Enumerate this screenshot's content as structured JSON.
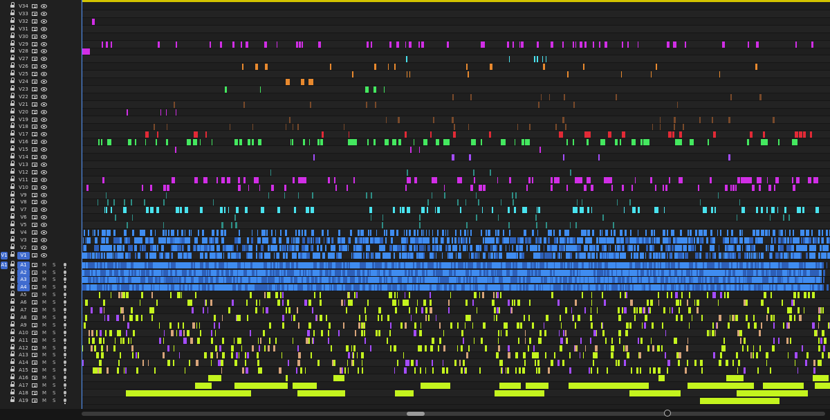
{
  "video_tracks": [
    "V34",
    "V33",
    "V32",
    "V31",
    "V30",
    "V29",
    "V28",
    "V27",
    "V26",
    "V25",
    "V24",
    "V23",
    "V22",
    "V21",
    "V20",
    "V19",
    "V18",
    "V17",
    "V16",
    "V15",
    "V14",
    "V13",
    "V12",
    "V11",
    "V10",
    "V9",
    "V8",
    "V7",
    "V6",
    "V5",
    "V4",
    "V3",
    "V2",
    "V1"
  ],
  "audio_tracks": [
    "A1",
    "A2",
    "A3",
    "A4",
    "A5",
    "A6",
    "A7",
    "A8",
    "A9",
    "A10",
    "A11",
    "A12",
    "A13",
    "A14",
    "A15",
    "A16",
    "A17",
    "A18",
    "A19"
  ],
  "source_patch": {
    "video": "V1",
    "audio": "A1"
  },
  "mute_label": "M",
  "solo_label": "S",
  "colors": {
    "magenta": "#d12ee6",
    "violet": "#a44cff",
    "cyan": "#49e3ef",
    "teal": "#2e8f86",
    "green": "#44e85f",
    "red": "#e22a36",
    "orange": "#e8892e",
    "brown": "#7a4a2a",
    "blue": "#3f8cf0",
    "dark_blue": "#2d5fb8",
    "lime": "#c4f41e",
    "tan": "#d9a57a",
    "workarea": "#d3c400"
  }
}
